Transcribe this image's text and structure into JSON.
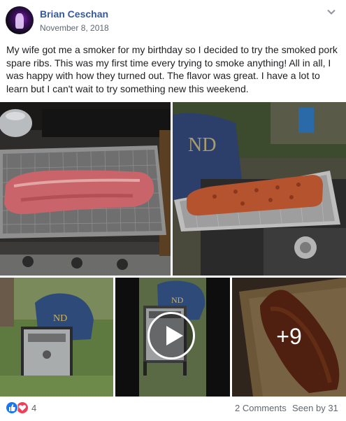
{
  "post": {
    "author": "Brian Ceschan",
    "date": "November 8, 2018",
    "text": "My wife got me a smoker for my birthday so I decided to try the smoked pork spare ribs. This was my first time every trying to smoke anything! All in all, I was happy with how they turned out. The flavor was great. I have a lot to learn but I can't wait to try something new this weekend.",
    "more_photos": "+9"
  },
  "footer": {
    "reaction_count": "4",
    "comments": "2 Comments",
    "seen_by": "Seen by 31"
  },
  "icons": {
    "options": "chevron-down-icon",
    "like": "thumbs-up-icon",
    "love": "heart-icon",
    "play": "play-icon"
  },
  "colors": {
    "author_link": "#385898",
    "meta_text": "#606770",
    "like": "#1877f2",
    "love": "#f33e58"
  }
}
